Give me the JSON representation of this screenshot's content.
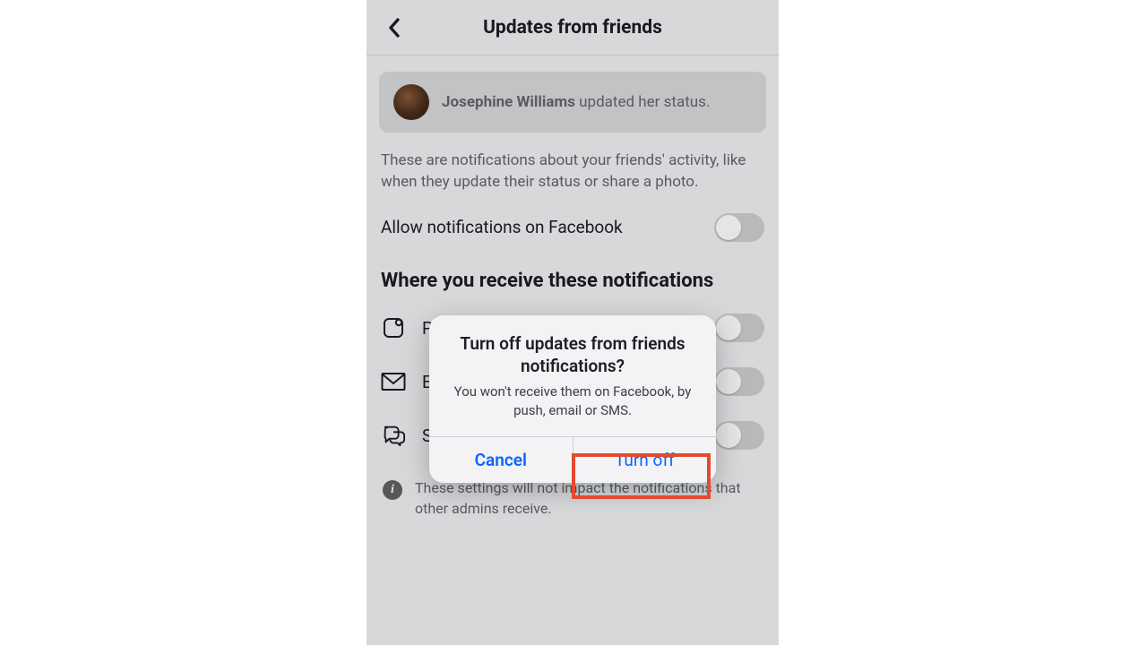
{
  "header": {
    "title": "Updates from friends"
  },
  "example": {
    "name": "Josephine Williams",
    "suffix": " updated her status."
  },
  "description": "These are notifications about your friends' activity, like when they update their status or share a photo.",
  "mainToggle": {
    "label": "Allow notifications on Facebook"
  },
  "sectionHeading": "Where you receive these notifications",
  "channels": [
    {
      "label": "Push"
    },
    {
      "label": "Email"
    },
    {
      "label": "SMS"
    }
  ],
  "infoNote": "These settings will not impact the notifications that other admins receive.",
  "modal": {
    "title": "Turn off updates from friends notifications?",
    "description": "You won't receive them on Facebook, by push, email or SMS.",
    "cancel": "Cancel",
    "confirm": "Turn off"
  }
}
